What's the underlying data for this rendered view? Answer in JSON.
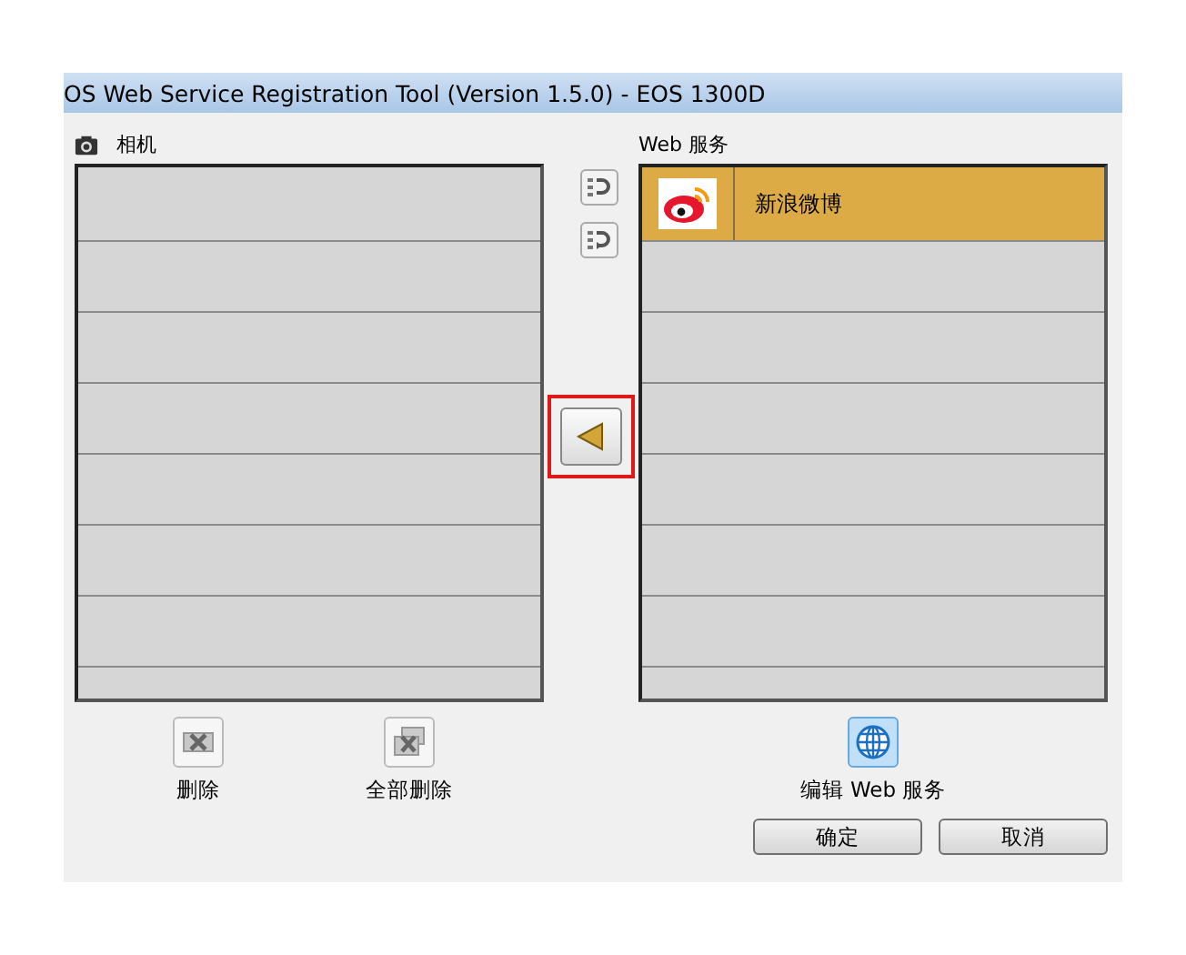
{
  "window": {
    "title": "OS Web Service Registration Tool (Version 1.5.0) - EOS 1300D"
  },
  "camera": {
    "label": "相机",
    "actions": [
      {
        "label": "删除"
      },
      {
        "label": "全部删除"
      }
    ]
  },
  "web_services": {
    "label": "Web 服务",
    "items": [
      {
        "name": "新浪微博",
        "selected": true
      }
    ],
    "edit": {
      "label": "编辑 Web 服务"
    }
  },
  "buttons": [
    {
      "label": "确定"
    },
    {
      "label": "取消"
    }
  ]
}
